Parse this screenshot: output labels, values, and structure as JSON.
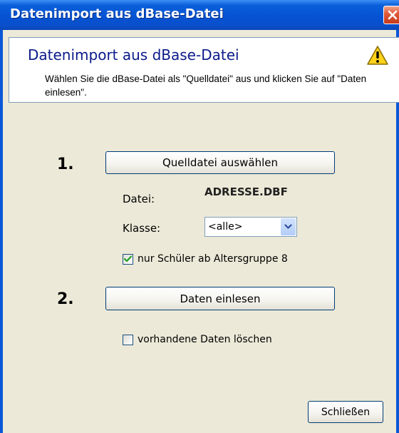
{
  "window": {
    "title": "Datenimport aus dBase-Datei"
  },
  "header": {
    "title": "Datenimport aus dBase-Datei",
    "description": "Wählen Sie die dBase-Datei als \"Quelldatei\" aus und klicken Sie auf \"Daten einlesen\"."
  },
  "step1": {
    "number": "1.",
    "button_label": "Quelldatei auswählen",
    "file_label": "Datei:",
    "file_value": "ADRESSE.DBF",
    "class_label": "Klasse:",
    "class_selected": "<alle>",
    "checkbox_label": "nur Schüler ab Altersgruppe 8",
    "checkbox_checked": true
  },
  "step2": {
    "number": "2.",
    "button_label": "Daten einlesen",
    "checkbox_label": "vorhandene Daten löschen",
    "checkbox_checked": false
  },
  "footer": {
    "close_label": "Schließen"
  },
  "icons": {
    "title_close": "close-icon",
    "header_warning": "warning-icon",
    "select_arrow": "chevron-down-icon",
    "check": "checkmark-icon"
  },
  "colors": {
    "titlebar": "#0553d4",
    "header_title": "#0b1a8a",
    "dialog_background": "#ece9d8",
    "close_button": "#e05b3a"
  }
}
